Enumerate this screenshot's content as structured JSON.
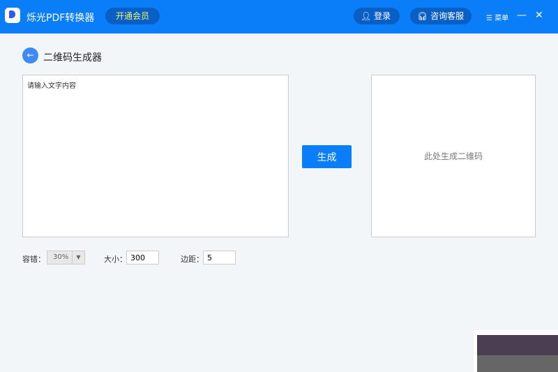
{
  "app": {
    "title": "烁光PDF转换器",
    "vip": "开通会员",
    "login": "登录",
    "support": "咨询客服",
    "menu": "☰ 菜单",
    "minimize": "—",
    "close": "✕"
  },
  "page": {
    "title": "二维码生成器",
    "input_placeholder": "请输入文字内容",
    "generate": "生成",
    "preview": "此处生成二维码"
  },
  "options": {
    "tolerance_label": "容错：",
    "tolerance": "30%",
    "size_label": "大小：",
    "size": "300",
    "margin_label": "边距：",
    "margin": "5"
  }
}
